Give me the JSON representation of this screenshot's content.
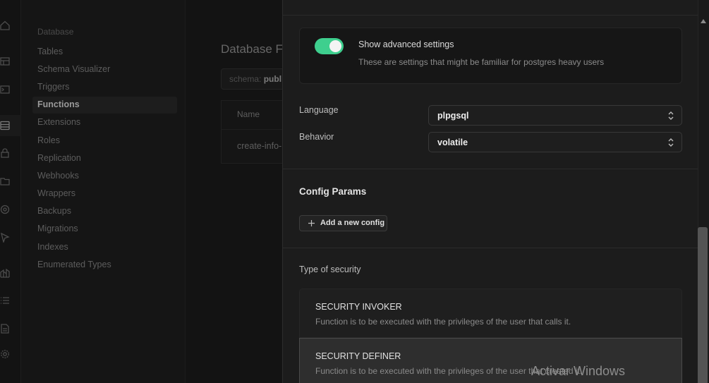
{
  "sidebar": {
    "heading": "Database",
    "items": [
      {
        "label": "Tables"
      },
      {
        "label": "Schema Visualizer"
      },
      {
        "label": "Triggers"
      },
      {
        "label": "Functions"
      },
      {
        "label": "Extensions"
      },
      {
        "label": "Roles"
      },
      {
        "label": "Replication"
      },
      {
        "label": "Webhooks"
      },
      {
        "label": "Wrappers"
      },
      {
        "label": "Backups"
      },
      {
        "label": "Migrations"
      },
      {
        "label": "Indexes"
      },
      {
        "label": "Enumerated Types"
      }
    ],
    "active": "Functions"
  },
  "background": {
    "title": "Database F",
    "schema_prefix": "schema:",
    "schema_value": "publ",
    "table_header": "Name",
    "table_row": "create-info-"
  },
  "panel": {
    "advanced": {
      "toggle_on": true,
      "label": "Show advanced settings",
      "description": "These are settings that might be familiar for postgres heavy users"
    },
    "language": {
      "label": "Language",
      "value": "plpgsql"
    },
    "behavior": {
      "label": "Behavior",
      "value": "volatile"
    },
    "config": {
      "title": "Config Params",
      "add_label": "Add a new config"
    },
    "security": {
      "label": "Type of security",
      "options": [
        {
          "title": "SECURITY INVOKER",
          "description": "Function is to be executed with the privileges of the user that calls it."
        },
        {
          "title": "SECURITY DEFINER",
          "description": "Function is to be executed with the privileges of the user that created it."
        }
      ]
    }
  },
  "watermark": "Activar Windows",
  "colors": {
    "accent": "#3ecf8e"
  }
}
